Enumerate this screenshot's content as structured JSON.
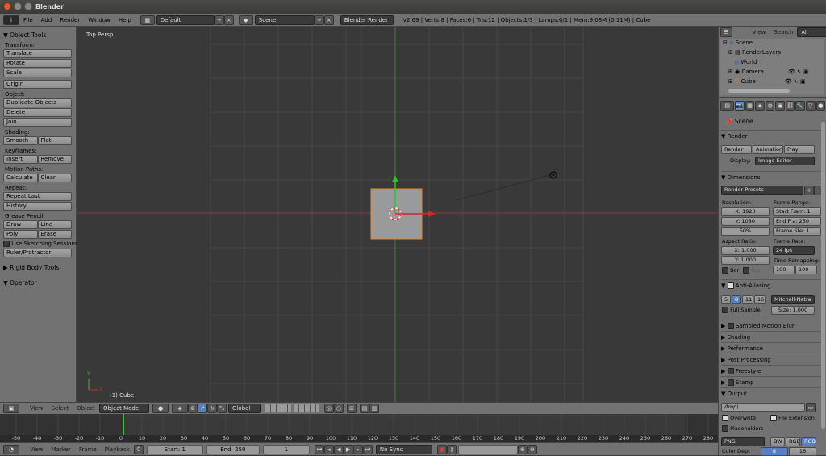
{
  "app": {
    "title": "Blender"
  },
  "menu": {
    "items": [
      "File",
      "Add",
      "Render",
      "Window",
      "Help"
    ],
    "layout": "Default",
    "scene": "Scene",
    "engine": "Blender Render",
    "stats": "v2.69 | Verts:8 | Faces:6 | Tris:12 | Objects:1/3 | Lamps:0/1 | Mem:9.08M (0.11M) | Cube"
  },
  "left": {
    "panel_title": "Object Tools",
    "transform": "Transform:",
    "translate": "Translate",
    "rotate": "Rotate",
    "scale": "Scale",
    "origin": "Origin",
    "object": "Object:",
    "duplicate": "Duplicate Objects",
    "delete": "Delete",
    "join": "Join",
    "shading": "Shading:",
    "smooth": "Smooth",
    "flat": "Flat",
    "keyframes": "Keyframes:",
    "insert": "Insert",
    "remove": "Remove",
    "motion": "Motion Paths:",
    "calculate": "Calculate",
    "clear": "Clear",
    "repeat": "Repeat:",
    "repeat_last": "Repeat Last",
    "history": "History...",
    "grease": "Grease Pencil:",
    "draw": "Draw",
    "line": "Line",
    "poly": "Poly",
    "erase": "Erase",
    "sketch": "Use Sketching Sessions",
    "ruler": "Ruler/Protractor",
    "rigid": "Rigid Body Tools",
    "operator": "Operator"
  },
  "viewport": {
    "view_label": "Top Persp",
    "object_label": "(1) Cube",
    "axis_y": "Y",
    "axis_x": "X"
  },
  "view3d_header": {
    "view": "View",
    "select": "Select",
    "object": "Object",
    "mode": "Object Mode",
    "orientation": "Global"
  },
  "timeline": {
    "ticks": [
      "-50",
      "-40",
      "-30",
      "-20",
      "-10",
      "0",
      "10",
      "20",
      "30",
      "40",
      "50",
      "60",
      "70",
      "80",
      "90",
      "100",
      "110",
      "120",
      "130",
      "140",
      "150",
      "160",
      "170",
      "180",
      "190",
      "200",
      "210",
      "220",
      "230",
      "240",
      "250",
      "260",
      "270",
      "280"
    ],
    "view": "View",
    "marker": "Marker",
    "frame": "Frame",
    "playback": "Playback",
    "start": "Start: 1",
    "end": "End: 250",
    "current": "1",
    "sync": "No Sync"
  },
  "outliner": {
    "view": "View",
    "search": "Search",
    "all": "All Scenes",
    "items": [
      "Scene",
      "RenderLayers",
      "World",
      "Camera",
      "Cube"
    ]
  },
  "props": {
    "context": "Scene",
    "render": "Render",
    "render_btn": "Render",
    "anim_btn": "Animation",
    "play_btn": "Play",
    "display_label": "Display:",
    "display_val": "Image Editor",
    "dimensions": "Dimensions",
    "presets": "Render Presets",
    "resolution": "Resolution:",
    "res_x": "X: 1920",
    "res_y": "Y: 1080",
    "res_pct": "50%",
    "frame_range": "Frame Range:",
    "start_frame": "Start Fram: 1",
    "end_frame": "End Fra: 250",
    "frame_step": "Frame Ste: 1",
    "aspect": "Aspect Ratio:",
    "asp_x": "X: 1.000",
    "asp_y": "Y: 1.000",
    "frame_rate": "Frame Rate:",
    "fps": "24 fps",
    "time_remap": "Time Remapping:",
    "remap_old": "100",
    "remap_new": "100",
    "bor": "Bor",
    "cro": "Cro",
    "aa": "Anti-Aliasing",
    "aa_vals": [
      "5",
      "8",
      "11",
      "16"
    ],
    "aa_filter": "Mitchell-Netra",
    "full_sample": "Full Sample",
    "size": "Size: 1.000",
    "motion_blur": "Sampled Motion Blur",
    "shading": "Shading",
    "performance": "Performance",
    "post": "Post Processing",
    "freestyle": "Freestyle",
    "stamp": "Stamp",
    "output": "Output",
    "path": "/tmp\\",
    "overwrite": "Overwrite",
    "file_ext": "File Extension",
    "placeholders": "Placeholders",
    "format": "PNG",
    "bw": "BW",
    "rgb": "RGB",
    "rgba": "RGBA",
    "color_depth": "Color Dept",
    "depth_8": "8",
    "depth_16": "16"
  }
}
